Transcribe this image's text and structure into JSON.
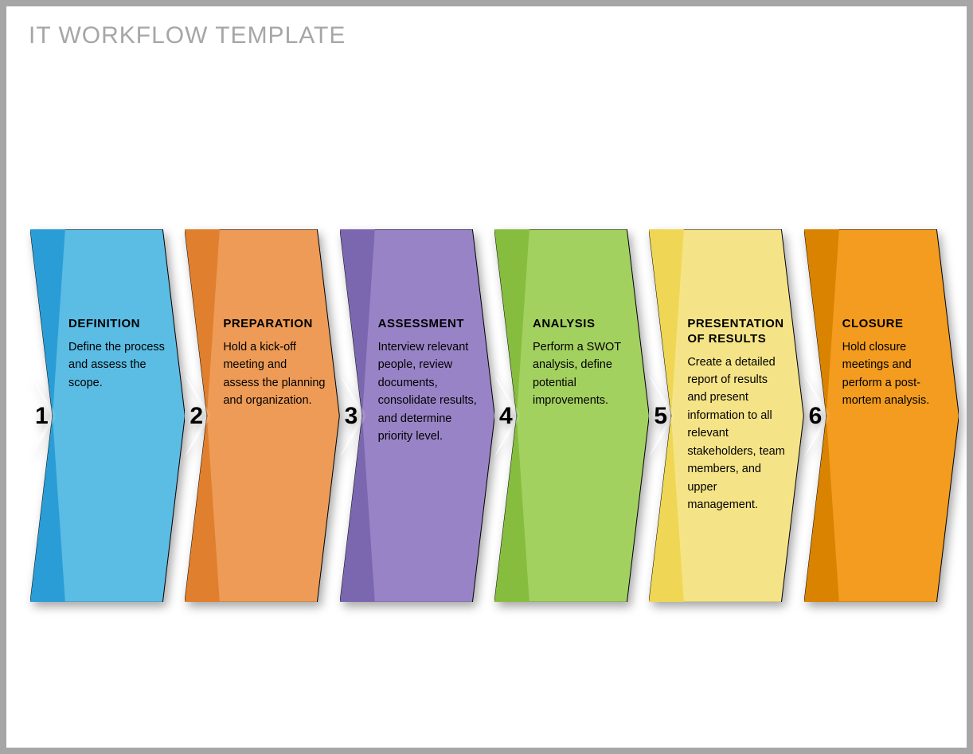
{
  "title": "IT WORKFLOW TEMPLATE",
  "steps": [
    {
      "num": "1",
      "title": "DEFINITION",
      "desc": "Define the process and assess the scope.",
      "fill": "#5bbce4",
      "shade": "#2a9dd6"
    },
    {
      "num": "2",
      "title": "PREPARATION",
      "desc": "Hold a kick-off meeting and assess the planning and organization.",
      "fill": "#ed9b56",
      "shade": "#e07f2e"
    },
    {
      "num": "3",
      "title": "ASSESSMENT",
      "desc": "Interview relevant people, review documents, consolidate results, and determine priority level.",
      "fill": "#9883c6",
      "shade": "#7b67af"
    },
    {
      "num": "4",
      "title": "ANALYSIS",
      "desc": "Perform a SWOT analysis, define potential improvements.",
      "fill": "#a3d160",
      "shade": "#86bd3f"
    },
    {
      "num": "5",
      "title": "PRESENTATION OF RESULTS",
      "desc": "Create a detailed report of results and present information to all relevant stakeholders, team members, and upper management.",
      "fill": "#f5e487",
      "shade": "#efd755"
    },
    {
      "num": "6",
      "title": "CLOSURE",
      "desc": "Hold closure meetings and perform a post-mortem analysis.",
      "fill": "#f39c1f",
      "shade": "#d98300"
    }
  ]
}
